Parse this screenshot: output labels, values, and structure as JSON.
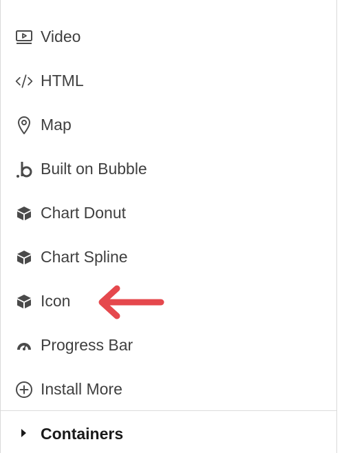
{
  "items": [
    {
      "label": "Video",
      "icon": "video-icon"
    },
    {
      "label": "HTML",
      "icon": "code-icon"
    },
    {
      "label": "Map",
      "icon": "map-pin-icon"
    },
    {
      "label": "Built on Bubble",
      "icon": "bubble-logo-icon"
    },
    {
      "label": "Chart Donut",
      "icon": "cube-icon"
    },
    {
      "label": "Chart Spline",
      "icon": "cube-icon"
    },
    {
      "label": "Icon",
      "icon": "cube-icon"
    },
    {
      "label": "Progress Bar",
      "icon": "gauge-icon"
    },
    {
      "label": "Install More",
      "icon": "plus-circle-icon"
    }
  ],
  "section": {
    "label": "Containers"
  },
  "colors": {
    "text": "#3f3f3f",
    "section_text": "#1a1a1a",
    "icon": "#4a4a4a",
    "arrow": "#e5484d",
    "divider": "#dcdcdc"
  }
}
